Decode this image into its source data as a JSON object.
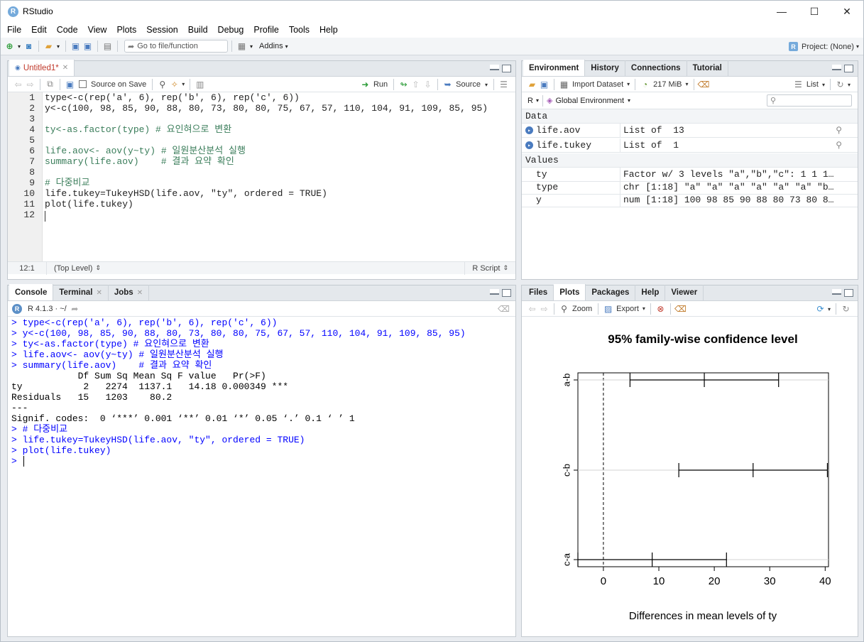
{
  "window": {
    "title": "RStudio",
    "minimize": "—",
    "maximize": "☐",
    "close": "✕"
  },
  "menu": [
    "File",
    "Edit",
    "Code",
    "View",
    "Plots",
    "Session",
    "Build",
    "Debug",
    "Profile",
    "Tools",
    "Help"
  ],
  "toolbar": {
    "goto_placeholder": "Go to file/function",
    "addins": "Addins",
    "project": "Project: (None)"
  },
  "source": {
    "tab_label": "Untitled1*",
    "source_on_save": "Source on Save",
    "run": "Run",
    "source_btn": "Source",
    "lines": [
      "type<-c(rep('a', 6), rep('b', 6), rep('c', 6))",
      "y<-c(100, 98, 85, 90, 88, 80, 73, 80, 80, 75, 67, 57, 110, 104, 91, 109, 85, 95)",
      "",
      "ty<-as.factor(type) # 요인혀으로 변환",
      "",
      "life.aov<- aov(y~ty) # 일원분산분석 실행",
      "summary(life.aov)    # 결과 요약 확인",
      "",
      "# 다중비교",
      "life.tukey=TukeyHSD(life.aov, \"ty\", ordered = TRUE)",
      "plot(life.tukey)",
      ""
    ],
    "status": {
      "position": "12:1",
      "scope": "(Top Level)",
      "type": "R Script"
    }
  },
  "console": {
    "tabs": [
      "Console",
      "Terminal",
      "Jobs"
    ],
    "version": "R 4.1.3 · ~/",
    "lines": [
      {
        "t": "> type<-c(rep('a', 6), rep('b', 6), rep('c', 6))",
        "k": "in"
      },
      {
        "t": "> y<-c(100, 98, 85, 90, 88, 80, 73, 80, 80, 75, 67, 57, 110, 104, 91, 109, 85, 95)",
        "k": "in"
      },
      {
        "t": "> ty<-as.factor(type) # 요인혀으로 변환",
        "k": "in"
      },
      {
        "t": "> life.aov<- aov(y~ty) # 일원분산분석 실행",
        "k": "in"
      },
      {
        "t": "> summary(life.aov)    # 결과 요약 확인",
        "k": "in"
      },
      {
        "t": "            Df Sum Sq Mean Sq F value   Pr(>F)    ",
        "k": "out"
      },
      {
        "t": "ty           2   2274  1137.1   14.18 0.000349 ***",
        "k": "out"
      },
      {
        "t": "Residuals   15   1203    80.2                     ",
        "k": "out"
      },
      {
        "t": "---",
        "k": "out"
      },
      {
        "t": "Signif. codes:  0 ‘***’ 0.001 ‘**’ 0.01 ‘*’ 0.05 ‘.’ 0.1 ‘ ’ 1",
        "k": "out"
      },
      {
        "t": "> # 다중비교",
        "k": "in"
      },
      {
        "t": "> life.tukey=TukeyHSD(life.aov, \"ty\", ordered = TRUE)",
        "k": "in"
      },
      {
        "t": "> plot(life.tukey)",
        "k": "in"
      },
      {
        "t": "> ",
        "k": "in"
      }
    ]
  },
  "environment": {
    "tabs": [
      "Environment",
      "History",
      "Connections",
      "Tutorial"
    ],
    "import": "Import Dataset",
    "memory": "217 MiB",
    "view": "List",
    "lang": "R",
    "scope": "Global Environment",
    "data_header": "Data",
    "data": [
      {
        "name": "life.aov",
        "value": "List of  13"
      },
      {
        "name": "life.tukey",
        "value": "List of  1"
      }
    ],
    "values_header": "Values",
    "values": [
      {
        "name": "ty",
        "value": "Factor w/ 3 levels \"a\",\"b\",\"c\": 1 1 1…"
      },
      {
        "name": "type",
        "value": "chr [1:18] \"a\" \"a\" \"a\" \"a\" \"a\" \"a\" \"b…"
      },
      {
        "name": "y",
        "value": "num [1:18] 100 98 85 90 88 80 73 80 8…"
      }
    ]
  },
  "files": {
    "tabs": [
      "Files",
      "Plots",
      "Packages",
      "Help",
      "Viewer"
    ],
    "zoom": "Zoom",
    "export": "Export"
  },
  "chart_data": {
    "type": "scatter",
    "title": "95% family-wise confidence level",
    "xlabel": "Differences in mean levels of ty",
    "ylabel": "",
    "xlim": [
      -4.6,
      40.6
    ],
    "xticks": [
      0,
      10,
      20,
      30,
      40
    ],
    "categories": [
      "a-b",
      "c-b",
      "c-a"
    ],
    "series": [
      {
        "estimate": [
          18.2,
          27.0,
          8.8
        ],
        "lower": [
          4.8,
          13.6,
          -4.6
        ],
        "upper": [
          31.6,
          40.4,
          22.2
        ]
      }
    ],
    "reference_line": 0,
    "grid": false
  }
}
